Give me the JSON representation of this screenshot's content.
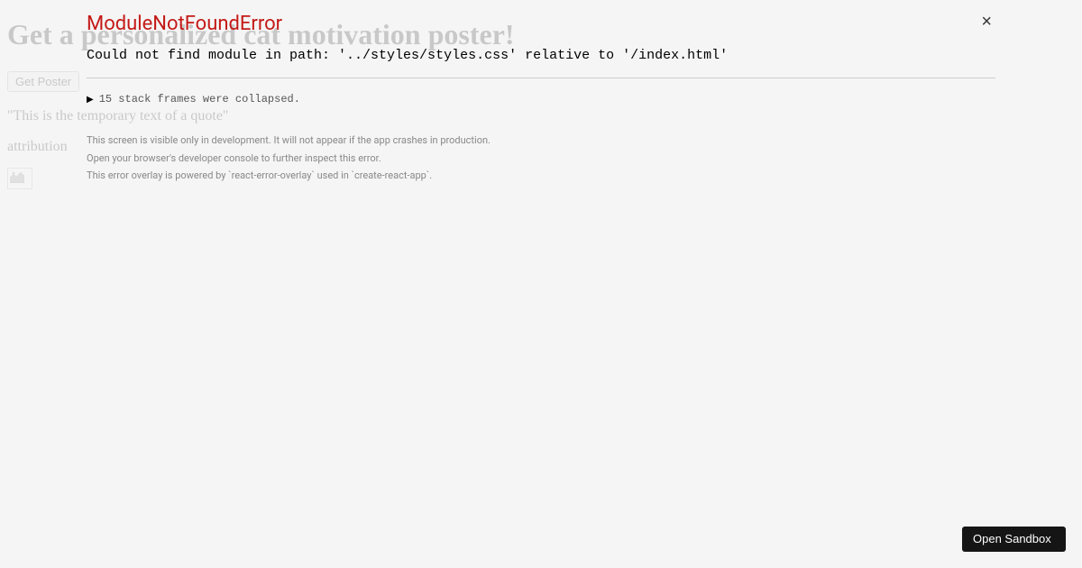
{
  "background": {
    "heading": "Get a personalized cat motivation poster!",
    "button_label": "Get Poster",
    "quote": "\"This is the temporary text of a quote\"",
    "attribution": "attribution"
  },
  "overlay": {
    "close_glyph": "×",
    "error_name": "ModuleNotFoundError",
    "error_message": "Could not find module in path: '../styles/styles.css' relative to '/index.html'",
    "stack_toggle": "15 stack frames were collapsed.",
    "info_line_1": "This screen is visible only in development. It will not appear if the app crashes in production.",
    "info_line_2": "Open your browser's developer console to further inspect this error.",
    "info_line_3": "This error overlay is powered by `react-error-overlay` used in `create-react-app`."
  },
  "sandbox": {
    "button_label": "Open Sandbox"
  }
}
